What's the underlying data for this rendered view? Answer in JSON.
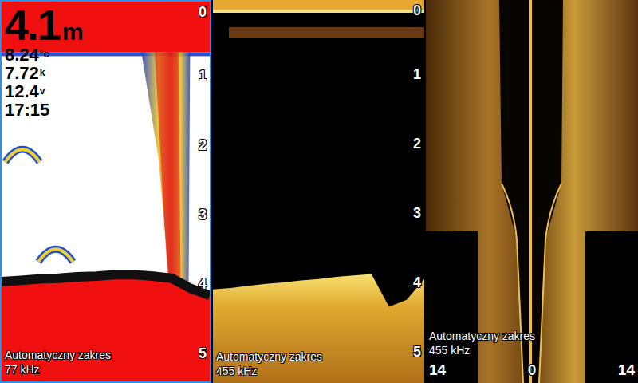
{
  "panels": [
    {
      "kind": "sonar-2d",
      "selected": true,
      "range_label": "Automatyczny zakres",
      "frequency": "77 kHz",
      "depth_ticks": [
        "0",
        "1",
        "2",
        "3",
        "4",
        "5"
      ],
      "readouts": [
        {
          "kind": "depth",
          "value": "4.1",
          "unit": "m"
        },
        {
          "kind": "small",
          "value": "8.24",
          "unit": "°c"
        },
        {
          "kind": "small",
          "value": "7.72",
          "unit": "k"
        },
        {
          "kind": "small",
          "value": "12.4",
          "unit": "v"
        },
        {
          "kind": "small",
          "value": "17:15"
        }
      ],
      "bottom_depth_m": [
        4.0,
        3.98,
        3.96,
        3.95,
        3.93,
        3.92,
        3.9,
        3.9,
        3.92,
        3.95,
        4.1,
        4.2
      ],
      "fish": [
        {
          "time": 0.1,
          "depth_m": 2.1
        },
        {
          "time": 0.26,
          "depth_m": 3.55
        }
      ]
    },
    {
      "kind": "down-imaging",
      "selected": false,
      "range_label": "Automatyczny zakres",
      "frequency": "455 kHz",
      "depth_ticks": [
        "0",
        "1",
        "2",
        "3",
        "4",
        "5"
      ],
      "bottom_depth_m": [
        4.1,
        4.08,
        4.05,
        4.02,
        4.0,
        3.97,
        3.95,
        3.92,
        3.9,
        3.88,
        4.35,
        4.25,
        3.95
      ]
    },
    {
      "kind": "side-imaging",
      "selected": false,
      "range_label": "Automatyczny zakres",
      "frequency": "455 kHz",
      "range_ticks": [
        "14",
        "0",
        "14"
      ]
    }
  ]
}
